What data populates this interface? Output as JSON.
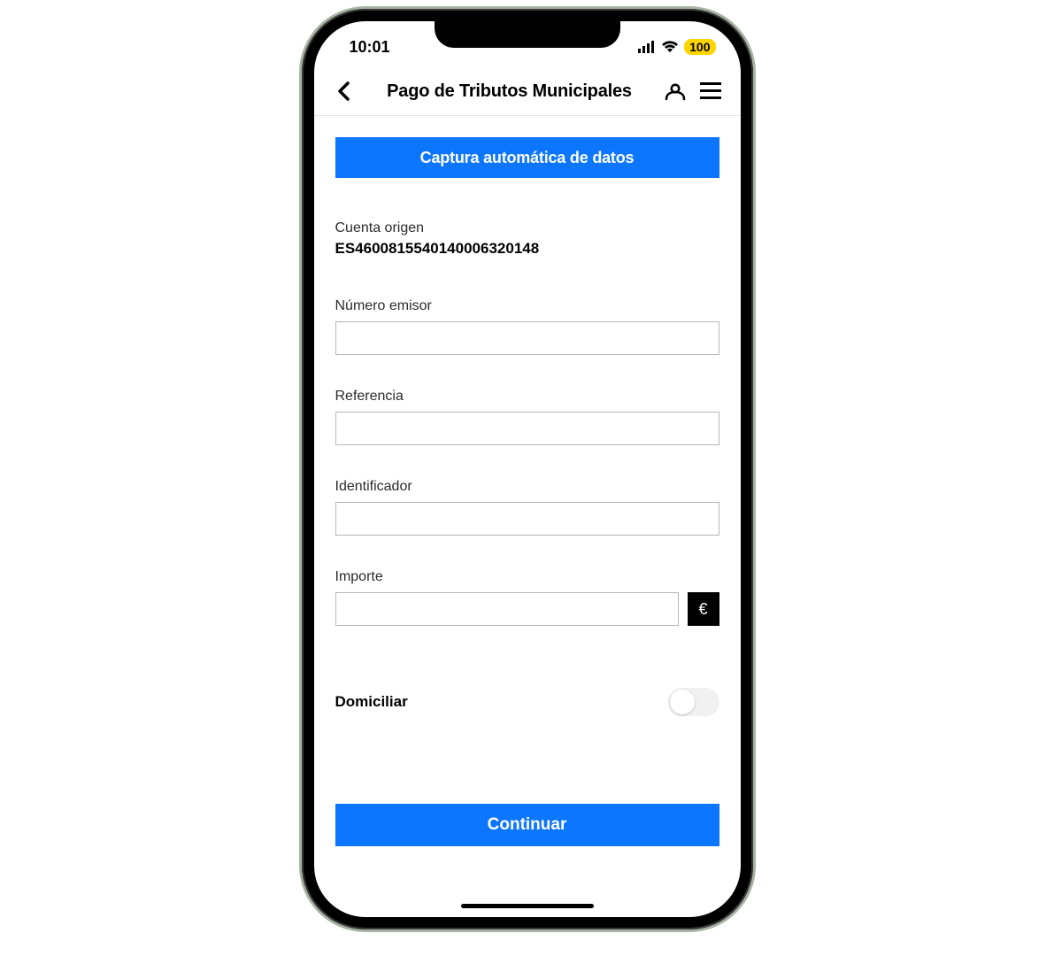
{
  "status": {
    "time": "10:01",
    "battery": "100"
  },
  "nav": {
    "title": "Pago de Tributos Municipales"
  },
  "capture_button_label": "Captura automática de datos",
  "origin_account": {
    "label": "Cuenta origen",
    "value": "ES4600815540140006320148"
  },
  "fields": {
    "issuer": {
      "label": "Número emisor",
      "value": ""
    },
    "reference": {
      "label": "Referencia",
      "value": ""
    },
    "identifier": {
      "label": "Identificador",
      "value": ""
    },
    "amount": {
      "label": "Importe",
      "value": "",
      "currency": "€"
    }
  },
  "domiciliar": {
    "label": "Domiciliar",
    "on": false
  },
  "continue_label": "Continuar"
}
